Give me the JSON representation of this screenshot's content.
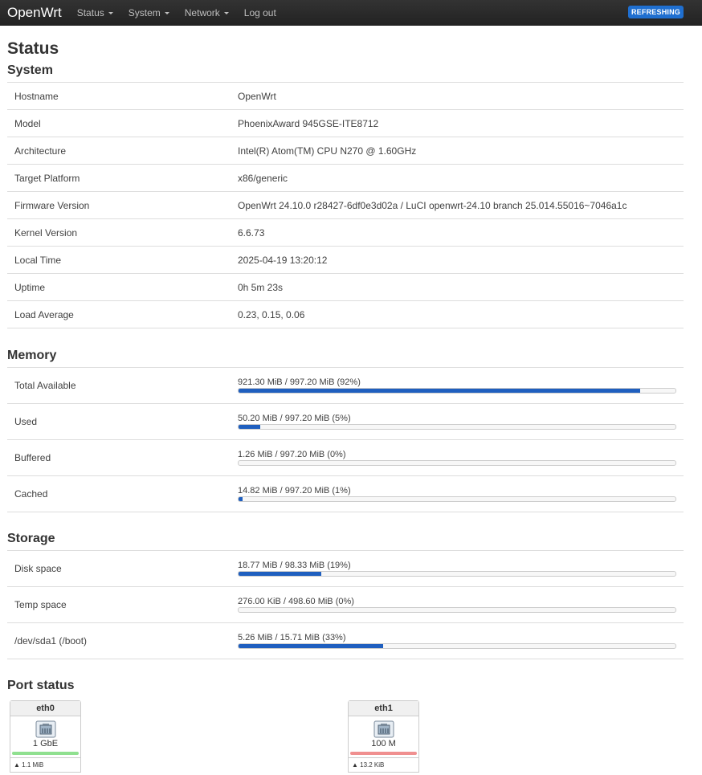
{
  "navbar": {
    "brand": "OpenWrt",
    "menu": [
      "Status",
      "System",
      "Network",
      "Log out"
    ],
    "badge": "REFRESHING"
  },
  "page_title": "Status",
  "system": {
    "title": "System",
    "rows": [
      {
        "label": "Hostname",
        "value": "OpenWrt"
      },
      {
        "label": "Model",
        "value": "PhoenixAward 945GSE-ITE8712"
      },
      {
        "label": "Architecture",
        "value": "Intel(R) Atom(TM) CPU N270 @ 1.60GHz"
      },
      {
        "label": "Target Platform",
        "value": "x86/generic"
      },
      {
        "label": "Firmware Version",
        "value": "OpenWrt 24.10.0 r28427-6df0e3d02a / LuCI openwrt-24.10 branch 25.014.55016~7046a1c"
      },
      {
        "label": "Kernel Version",
        "value": "6.6.73"
      },
      {
        "label": "Local Time",
        "value": "2025-04-19 13:20:12"
      },
      {
        "label": "Uptime",
        "value": "0h 5m 23s"
      },
      {
        "label": "Load Average",
        "value": "0.23, 0.15, 0.06"
      }
    ]
  },
  "memory": {
    "title": "Memory",
    "rows": [
      {
        "label": "Total Available",
        "text": "921.30 MiB / 997.20 MiB (92%)",
        "percent": 92
      },
      {
        "label": "Used",
        "text": "50.20 MiB / 997.20 MiB (5%)",
        "percent": 5
      },
      {
        "label": "Buffered",
        "text": "1.26 MiB / 997.20 MiB (0%)",
        "percent": 0
      },
      {
        "label": "Cached",
        "text": "14.82 MiB / 997.20 MiB (1%)",
        "percent": 1
      }
    ]
  },
  "storage": {
    "title": "Storage",
    "rows": [
      {
        "label": "Disk space",
        "text": "18.77 MiB / 98.33 MiB (19%)",
        "percent": 19
      },
      {
        "label": "Temp space",
        "text": "276.00 KiB / 498.60 MiB (0%)",
        "percent": 0
      },
      {
        "label": "/dev/sda1 (/boot)",
        "text": "5.26 MiB / 15.71 MiB (33%)",
        "percent": 33
      }
    ]
  },
  "ports": {
    "title": "Port status",
    "items": [
      {
        "name": "eth0",
        "speed": "1 GbE",
        "traffic": "▲ 1.1 MiB",
        "led_color": "#90e090"
      },
      {
        "name": "eth1",
        "speed": "100 M",
        "traffic": "▲ 13.2 KiB",
        "led_color": "#f09090"
      }
    ],
    "icon": "ethernet-port-icon"
  },
  "colors": {
    "accent": "#1f5fbf",
    "badge": "#1f6fd0"
  }
}
